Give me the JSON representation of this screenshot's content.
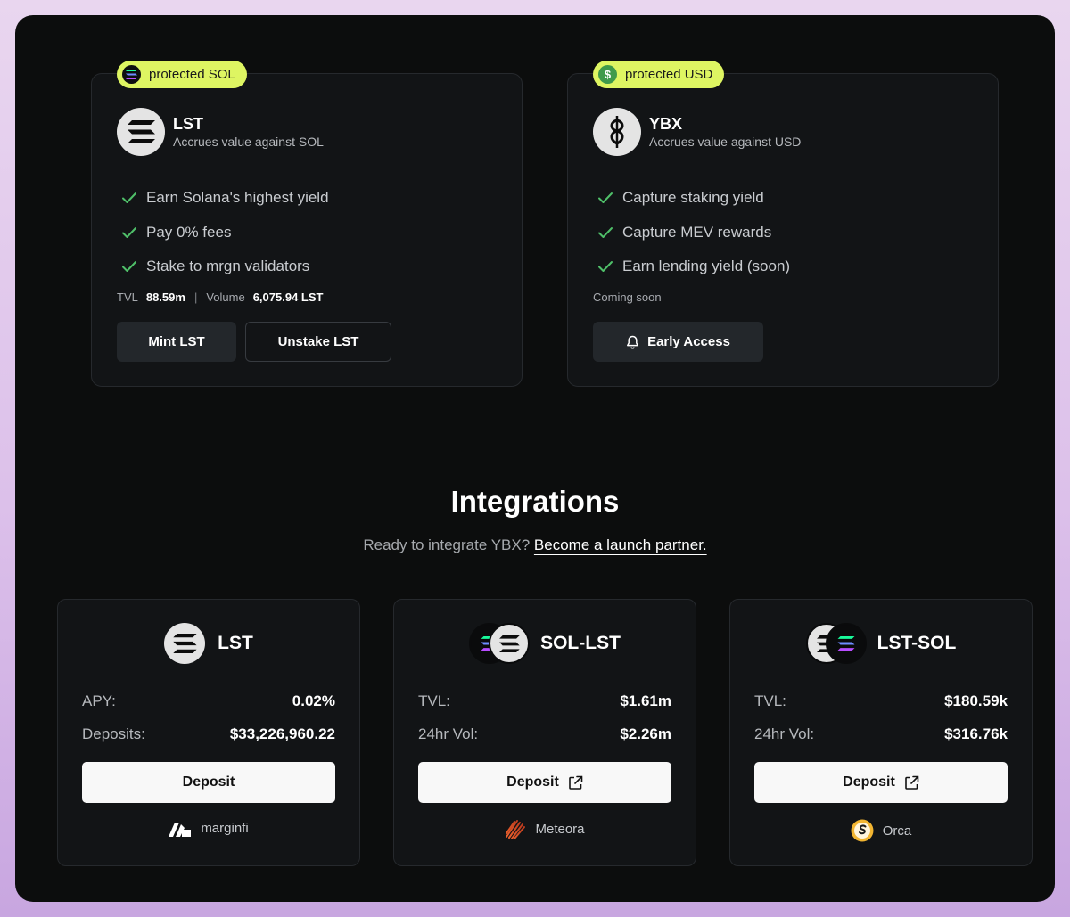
{
  "products": {
    "lst": {
      "pill": "protected SOL",
      "title": "LST",
      "subtitle": "Accrues value against SOL",
      "features": [
        "Earn Solana's highest yield",
        "Pay 0% fees",
        "Stake to mrgn validators"
      ],
      "tvl_label": "TVL",
      "tvl_value": "88.59m",
      "separator": "|",
      "volume_label": "Volume",
      "volume_value": "6,075.94 LST",
      "mint_button": "Mint LST",
      "unstake_button": "Unstake LST"
    },
    "ybx": {
      "pill": "protected USD",
      "pill_icon": "$",
      "title": "YBX",
      "subtitle": "Accrues value against USD",
      "features": [
        "Capture staking yield",
        "Capture MEV rewards",
        "Earn lending yield (soon)"
      ],
      "status": "Coming soon",
      "early_access_button": "Early Access"
    }
  },
  "integrations": {
    "title": "Integrations",
    "subtitle": "Ready to integrate YBX?",
    "link": "Become a launch partner.",
    "cards": [
      {
        "name": "LST",
        "stat1_label": "APY:",
        "stat1_value": "0.02%",
        "stat2_label": "Deposits:",
        "stat2_value": "$33,226,960.22",
        "button": "Deposit",
        "provider": "marginfi"
      },
      {
        "name": "SOL-LST",
        "stat1_label": "TVL:",
        "stat1_value": "$1.61m",
        "stat2_label": "24hr Vol:",
        "stat2_value": "$2.26m",
        "button": "Deposit",
        "provider": "Meteora"
      },
      {
        "name": "LST-SOL",
        "stat1_label": "TVL:",
        "stat1_value": "$180.59k",
        "stat2_label": "24hr Vol:",
        "stat2_value": "$316.76k",
        "button": "Deposit",
        "provider": "Orca"
      }
    ]
  },
  "colors": {
    "accent_pill": "#def562",
    "check_green": "#4fbf69",
    "card_bg": "#121416",
    "page_bg": "#0c0d0d"
  },
  "icons": [
    "solana-icon",
    "lst-logo-icon",
    "ybx-logo-icon",
    "dollar-icon",
    "check-icon",
    "bell-icon",
    "external-link-icon",
    "marginfi-icon",
    "meteora-icon",
    "orca-icon"
  ]
}
